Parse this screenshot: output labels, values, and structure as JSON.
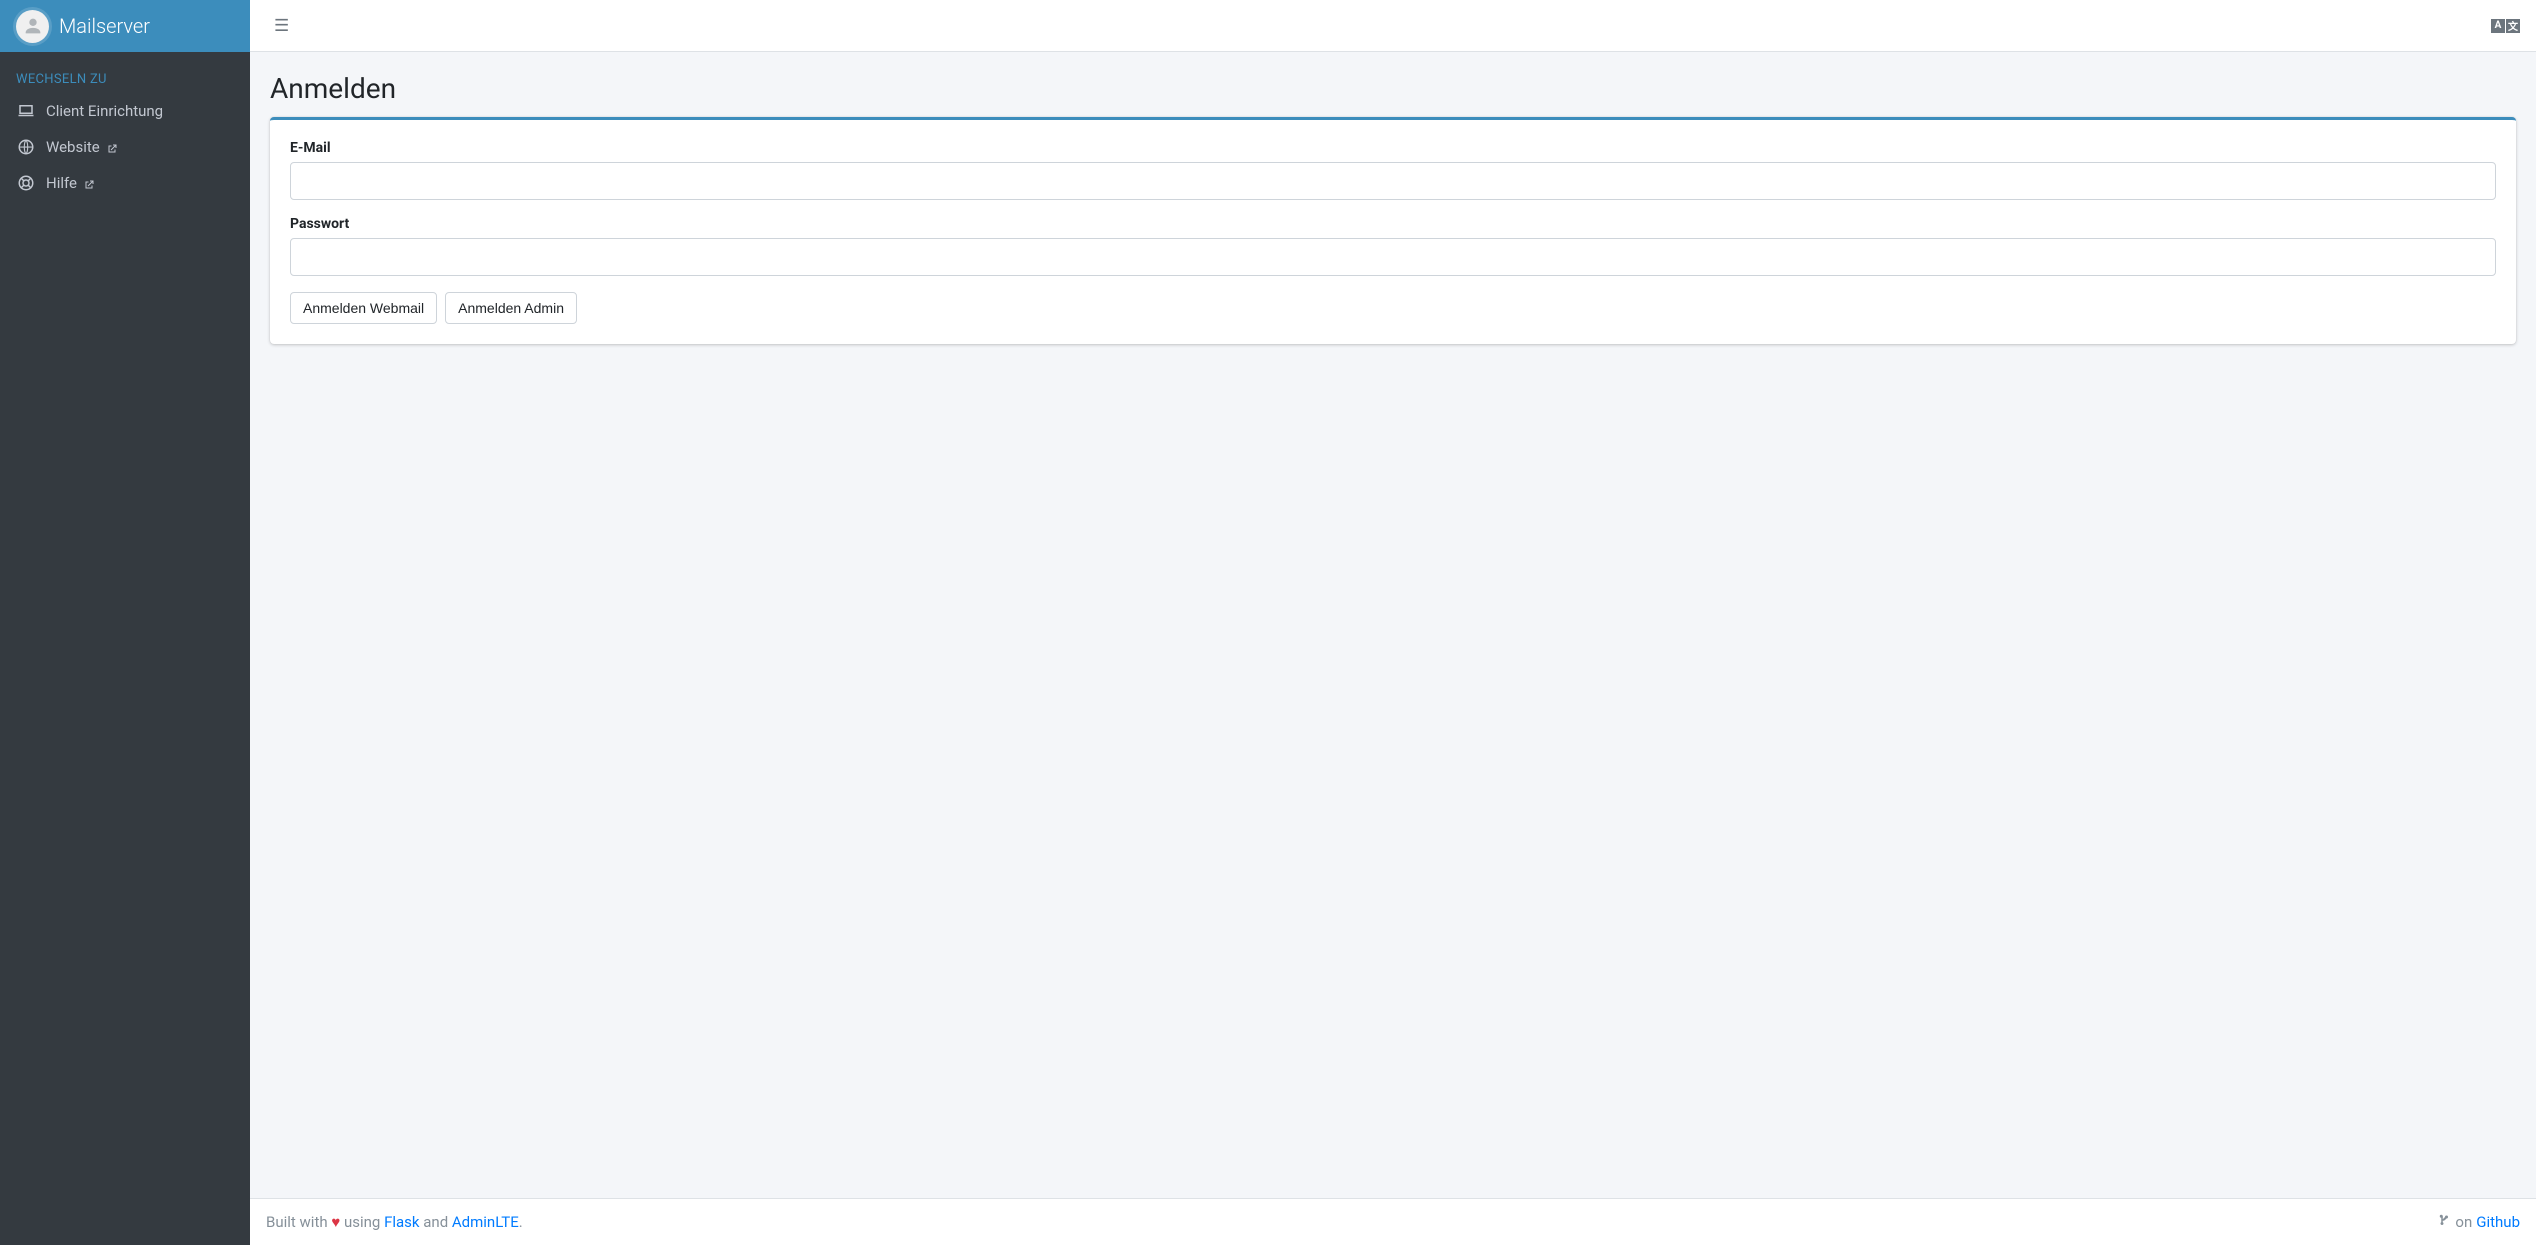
{
  "brand": {
    "title": "Mailserver"
  },
  "sidebar": {
    "section_header": "WECHSELN ZU",
    "items": [
      {
        "label": "Client Einrichtung",
        "icon": "laptop-icon",
        "external": false
      },
      {
        "label": "Website",
        "icon": "globe-icon",
        "external": true
      },
      {
        "label": "Hilfe",
        "icon": "lifebuoy-icon",
        "external": true
      }
    ]
  },
  "header": {
    "language_label_a": "A",
    "language_label_b": "文"
  },
  "page": {
    "title": "Anmelden"
  },
  "form": {
    "email_label": "E-Mail",
    "email_value": "",
    "password_label": "Passwort",
    "password_value": "",
    "submit_webmail": "Anmelden Webmail",
    "submit_admin": "Anmelden Admin"
  },
  "footer": {
    "built_with": "Built with ",
    "using": " using ",
    "flask": "Flask",
    "and": " and ",
    "adminlte": "AdminLTE",
    "period": ".",
    "on": " on ",
    "github": "Github"
  }
}
